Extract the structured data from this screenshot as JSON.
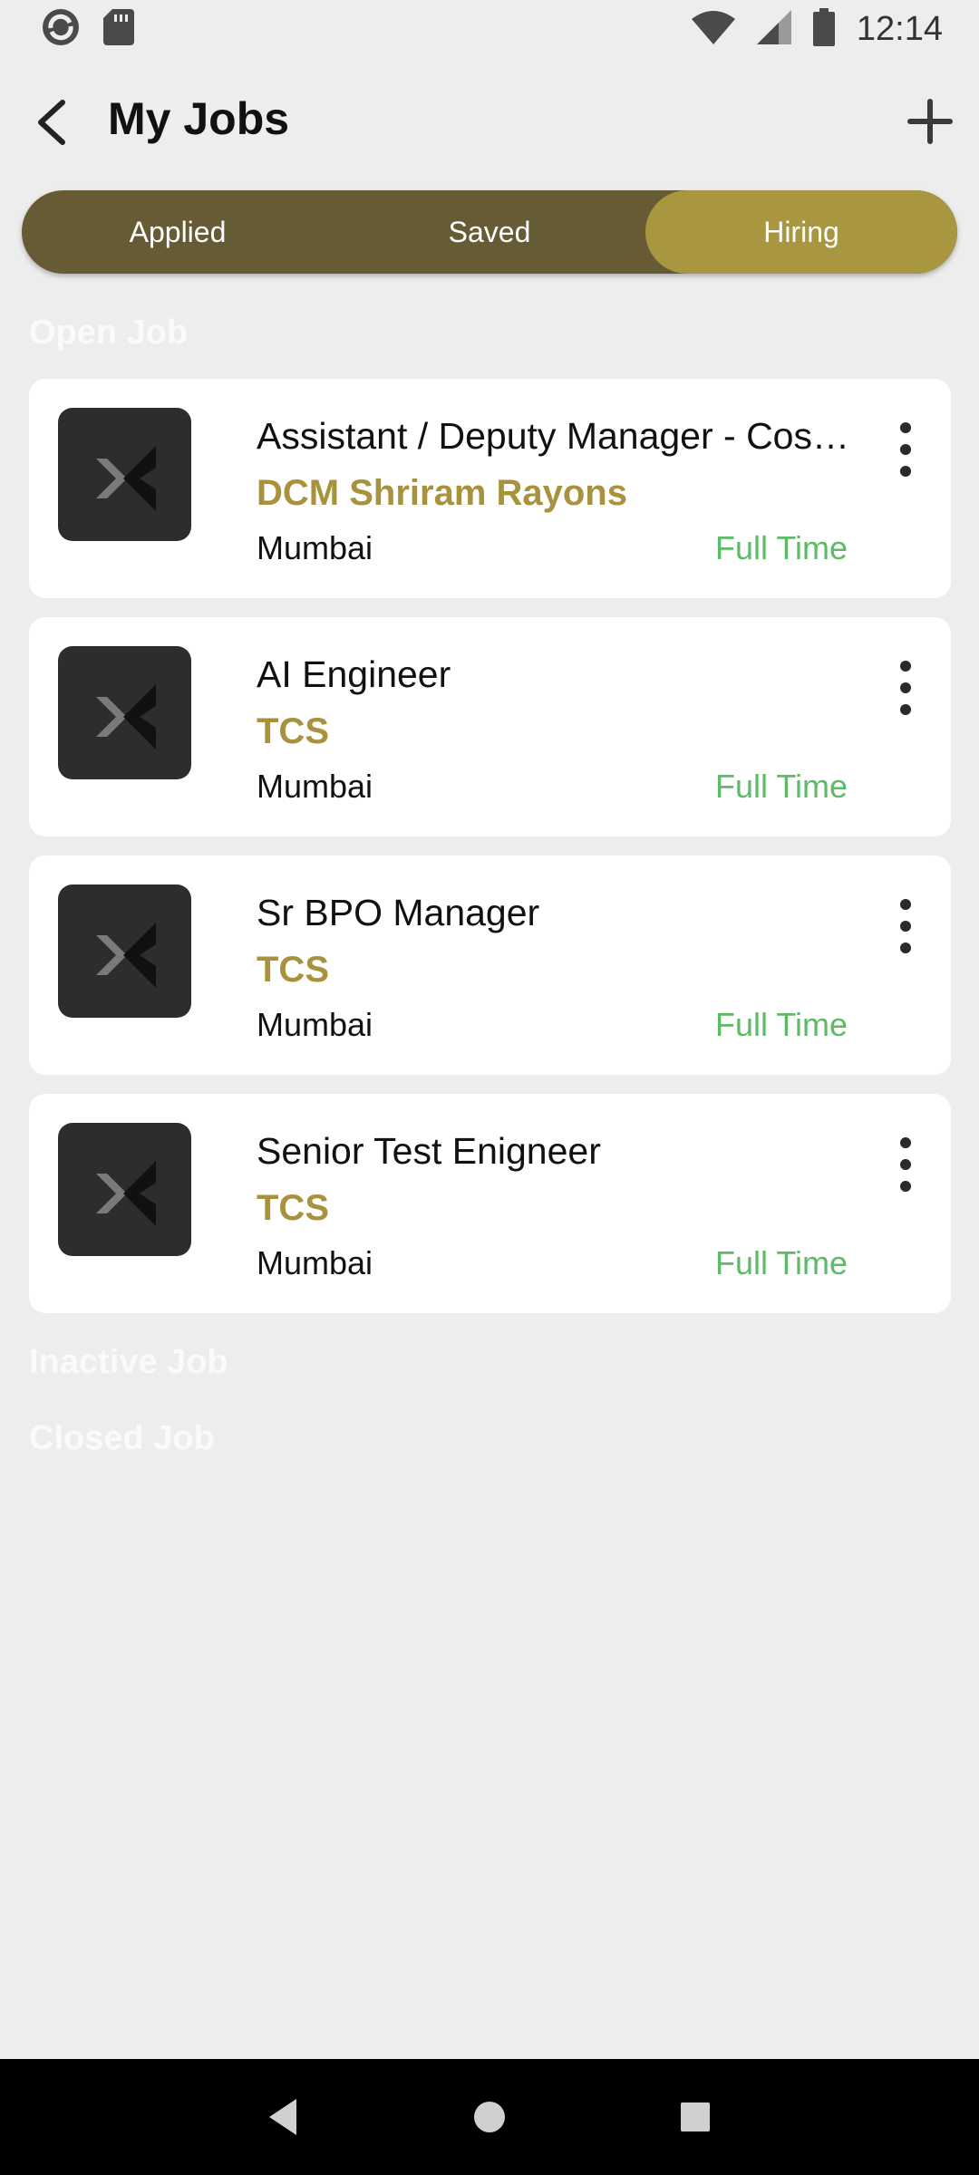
{
  "status_bar": {
    "time": "12:14",
    "icons": [
      "app-sync-icon",
      "sd-card-icon",
      "wifi-icon",
      "cell-signal-icon",
      "battery-icon"
    ]
  },
  "header": {
    "title": "My Jobs",
    "back_icon": "back-arrow-icon",
    "add_icon": "plus-icon"
  },
  "tabs": [
    {
      "label": "Applied",
      "active": false
    },
    {
      "label": "Saved",
      "active": false
    },
    {
      "label": "Hiring",
      "active": true
    }
  ],
  "sections": {
    "open": "Open Job",
    "inactive": "Inactive Job",
    "closed": "Closed Job"
  },
  "jobs": [
    {
      "title": "Assistant / Deputy Manager - Cos…",
      "company": "DCM Shriram Rayons",
      "location": "Mumbai",
      "type": "Full Time"
    },
    {
      "title": "AI Engineer",
      "company": "TCS",
      "location": "Mumbai",
      "type": "Full Time"
    },
    {
      "title": "Sr BPO Manager",
      "company": "TCS",
      "location": "Mumbai",
      "type": "Full Time"
    },
    {
      "title": "Senior Test Enigneer",
      "company": "TCS",
      "location": "Mumbai",
      "type": "Full Time"
    }
  ],
  "colors": {
    "tab_bg": "#675b35",
    "tab_active": "#a99641",
    "company": "#a9923e",
    "job_type": "#5dbb67"
  }
}
